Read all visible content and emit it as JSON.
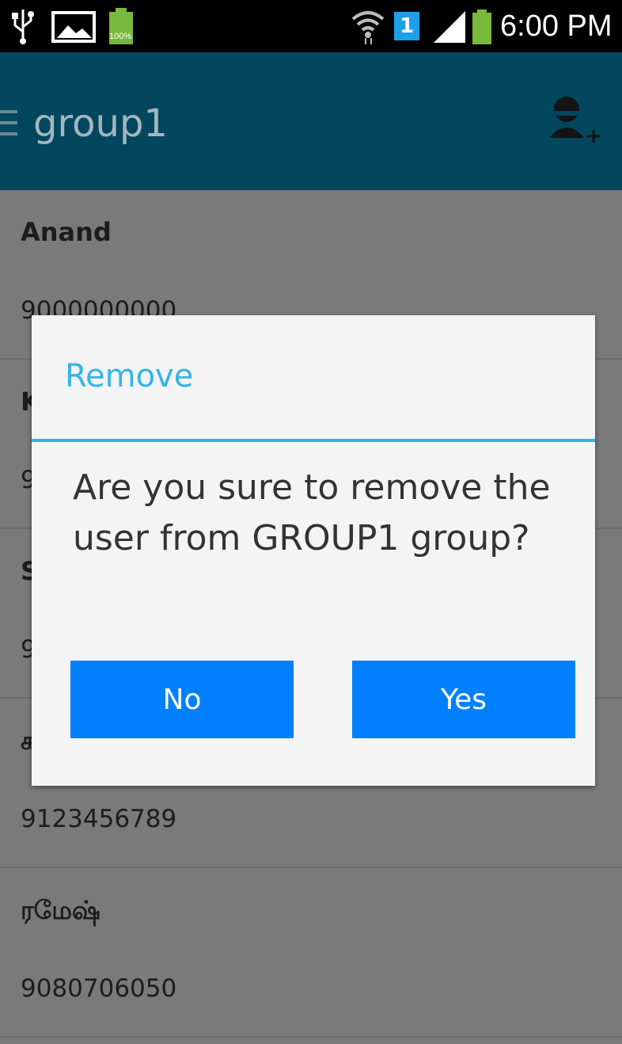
{
  "status_bar": {
    "time": "6:00 PM",
    "sim_slot": "1",
    "battery_percent_label": "100%"
  },
  "app_bar": {
    "title": "group1"
  },
  "contacts": [
    {
      "name": "Anand",
      "phone": "9000000000"
    },
    {
      "name": "K",
      "phone": "9"
    },
    {
      "name": "S",
      "phone": "9"
    },
    {
      "name": "க",
      "phone": "9123456789"
    },
    {
      "name": "ரமேஷ்",
      "phone": "9080706050"
    }
  ],
  "dialog": {
    "title": "Remove",
    "message": "Are you sure to remove the user from GROUP1 group?",
    "no_label": "No",
    "yes_label": "Yes"
  },
  "colors": {
    "status_bar": "#000000",
    "app_bar": "#02475e",
    "dialog_accent": "#33b5e5",
    "button": "#0080ff",
    "battery_green": "#78b83c"
  }
}
